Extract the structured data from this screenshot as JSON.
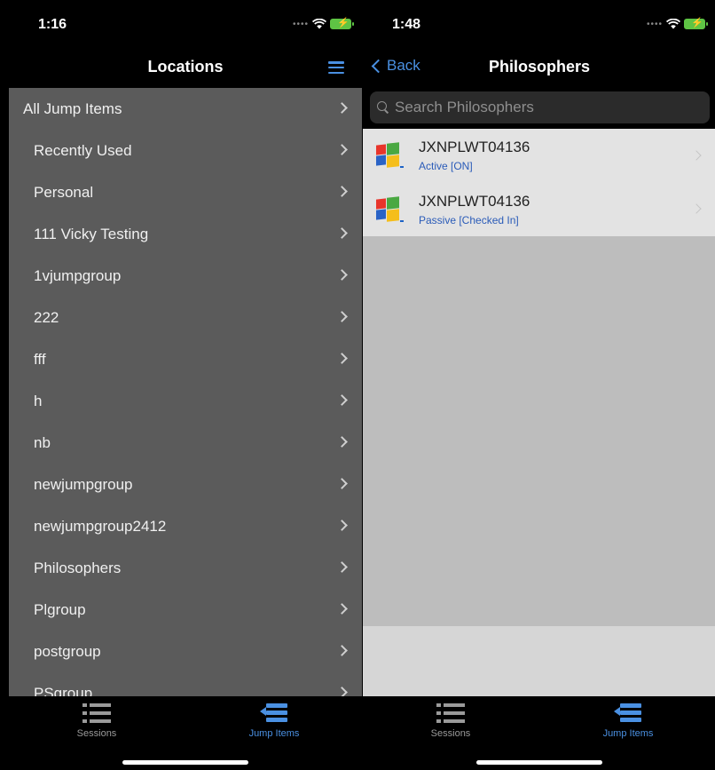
{
  "left_screen": {
    "status_time": "1:16",
    "nav_title": "Locations",
    "locations": [
      {
        "label": "All Jump Items"
      },
      {
        "label": "Recently Used"
      },
      {
        "label": "Personal"
      },
      {
        "label": "111 Vicky Testing"
      },
      {
        "label": "1vjumpgroup"
      },
      {
        "label": "222"
      },
      {
        "label": "fff"
      },
      {
        "label": "h"
      },
      {
        "label": "nb"
      },
      {
        "label": "newjumpgroup"
      },
      {
        "label": "newjumpgroup2412"
      },
      {
        "label": "Philosophers"
      },
      {
        "label": "Plgroup"
      },
      {
        "label": "postgroup"
      },
      {
        "label": "PSgroup"
      }
    ],
    "tabs": {
      "sessions": "Sessions",
      "jump_items": "Jump Items"
    }
  },
  "right_screen": {
    "status_time": "1:48",
    "back_label": "Back",
    "nav_title": "Philosophers",
    "search_placeholder": "Search Philosophers",
    "jump_items": [
      {
        "name": "JXNPLWT04136",
        "status": "Active [ON]",
        "icon": "windows-icon"
      },
      {
        "name": "JXNPLWT04136",
        "status": "Passive [Checked In]",
        "icon": "windows-icon"
      }
    ],
    "tabs": {
      "sessions": "Sessions",
      "jump_items": "Jump Items"
    }
  },
  "colors": {
    "accent": "#4a90e2",
    "list_background": "#5b5b5b",
    "status_link": "#2a5bb8"
  }
}
